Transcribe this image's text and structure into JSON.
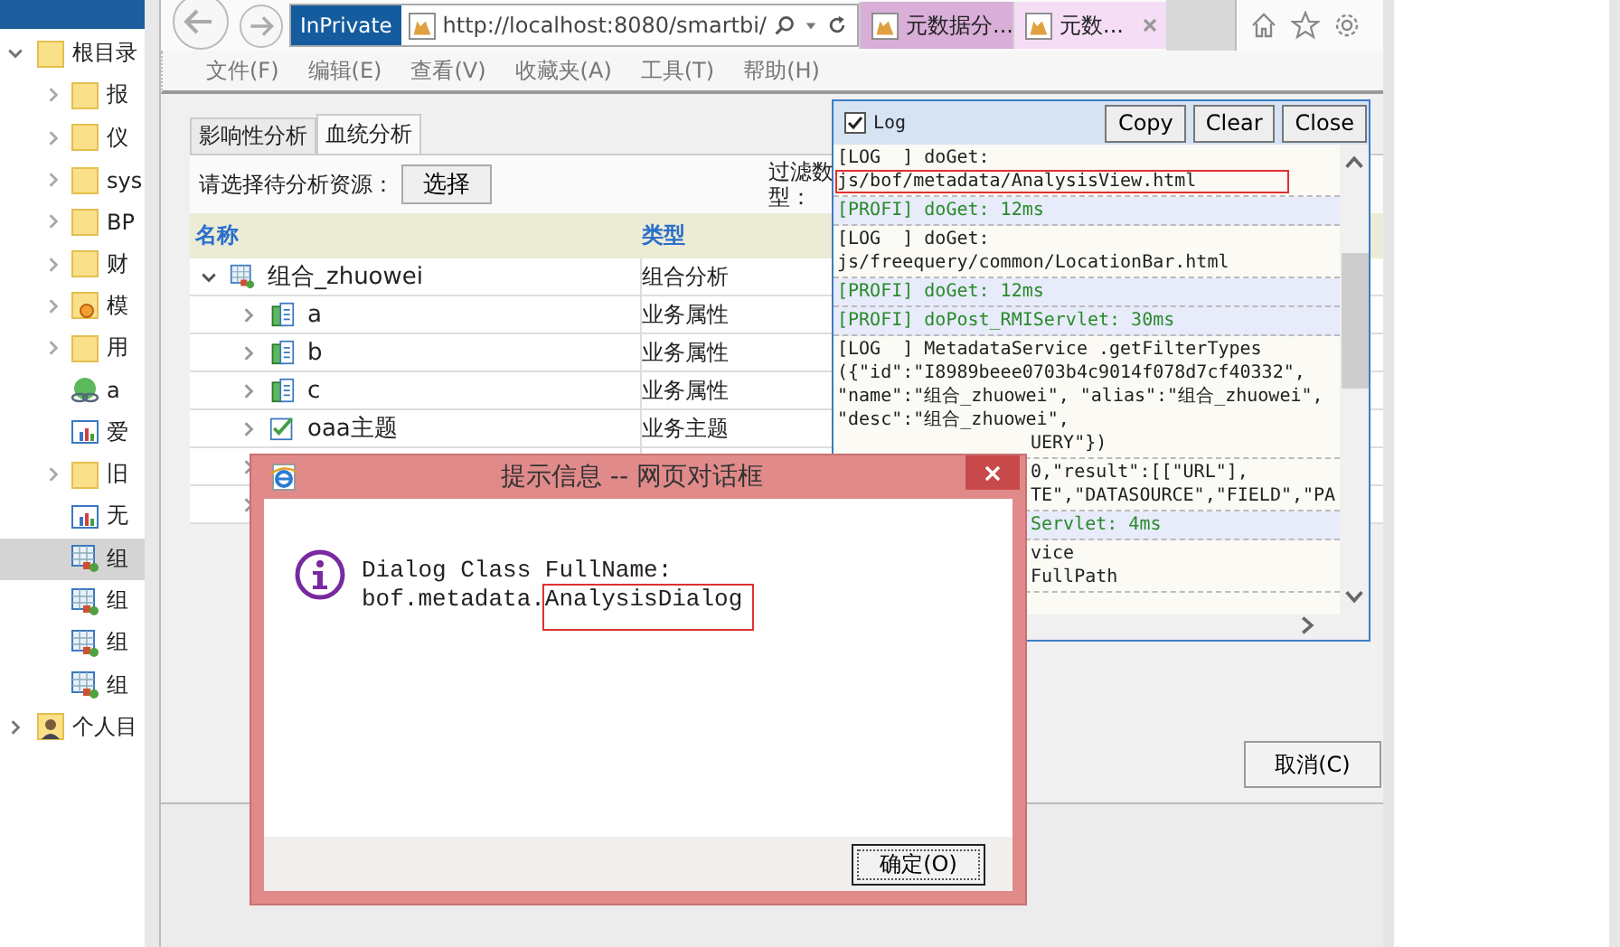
{
  "sidebar": {
    "items": [
      {
        "label": "根目录",
        "kind": "folder",
        "expanded": true,
        "selected": false,
        "children": [
          {
            "label": "报",
            "kind": "folder",
            "expanded": false,
            "selected": false
          },
          {
            "label": "仪",
            "kind": "folder",
            "expanded": false,
            "selected": false
          },
          {
            "label": "sys",
            "kind": "folder",
            "expanded": false,
            "selected": false
          },
          {
            "label": "BP",
            "kind": "folder",
            "expanded": false,
            "selected": false
          },
          {
            "label": "财",
            "kind": "folder",
            "expanded": false,
            "selected": false
          },
          {
            "label": "模",
            "kind": "model-folder",
            "expanded": false,
            "selected": false
          },
          {
            "label": "用",
            "kind": "folder",
            "expanded": false,
            "selected": false
          },
          {
            "label": "a",
            "kind": "link",
            "selected": false
          },
          {
            "label": "爱",
            "kind": "report",
            "selected": false
          },
          {
            "label": "旧",
            "kind": "folder",
            "expanded": false,
            "selected": false
          },
          {
            "label": "无",
            "kind": "report",
            "selected": false
          },
          {
            "label": "组",
            "kind": "combo",
            "selected": true
          },
          {
            "label": "组",
            "kind": "combo",
            "selected": false
          },
          {
            "label": "组",
            "kind": "combo",
            "selected": false
          },
          {
            "label": "组",
            "kind": "combo",
            "selected": false
          }
        ]
      },
      {
        "label": "个人目",
        "kind": "user-folder",
        "expanded": false,
        "selected": false
      }
    ]
  },
  "browser": {
    "private_label": "InPrivate",
    "url": "http://localhost:8080/smartbi/",
    "tabs": [
      {
        "label": "元数据分...",
        "selected": true
      },
      {
        "label": "元数...",
        "selected": false
      }
    ],
    "menu": [
      "文件(F)",
      "编辑(E)",
      "查看(V)",
      "收藏夹(A)",
      "工具(T)",
      "帮助(H)"
    ]
  },
  "page": {
    "tabs": [
      {
        "label": "影响性分析",
        "selected": false
      },
      {
        "label": "血统分析",
        "selected": true
      }
    ],
    "resource_label": "请选择待分析资源：",
    "select_button": "选择",
    "filter_label": "过滤数型：",
    "table": {
      "columns": [
        "名称",
        "类型"
      ],
      "rows": [
        {
          "name": "组合_zhuowei",
          "type": "组合分析",
          "kind": "combo",
          "expanded": true,
          "children": [
            {
              "name": "a",
              "type": "业务属性",
              "kind": "attribute",
              "expanded": false
            },
            {
              "name": "b",
              "type": "业务属性",
              "kind": "attribute",
              "expanded": false
            },
            {
              "name": "c",
              "type": "业务属性",
              "kind": "attribute",
              "expanded": false
            },
            {
              "name": "oaa主题",
              "type": "业务主题",
              "kind": "topic",
              "expanded": false
            },
            {
              "kind": "covered",
              "expanded": false
            },
            {
              "kind": "covered",
              "expanded": false
            }
          ]
        }
      ]
    },
    "cancel_button": "取消(C)"
  },
  "log": {
    "title": "Log",
    "checked": true,
    "buttons": [
      "Copy",
      "Clear",
      "Close"
    ],
    "entries": [
      {
        "kind": "log",
        "lines": [
          {
            "text": "[LOG  ] doGet:",
            "highlighted": false
          },
          {
            "text": "js/bof/metadata/AnalysisView.html",
            "highlighted": true
          }
        ]
      },
      {
        "kind": "profi",
        "lines": [
          {
            "text": "[PROFI] doGet: 12ms",
            "highlighted": false
          }
        ]
      },
      {
        "kind": "log",
        "lines": [
          {
            "text": "[LOG  ] doGet:",
            "highlighted": false
          },
          {
            "text": "js/freequery/common/LocationBar.html",
            "highlighted": false
          }
        ]
      },
      {
        "kind": "profi",
        "lines": [
          {
            "text": "[PROFI] doGet: 12ms",
            "highlighted": false
          }
        ]
      },
      {
        "kind": "profi",
        "lines": [
          {
            "text": "[PROFI] doPost_RMIServlet: 30ms",
            "highlighted": false
          }
        ]
      },
      {
        "kind": "log",
        "lines": [
          {
            "text": "[LOG  ] MetadataService .getFilterTypes",
            "highlighted": false
          },
          {
            "text": "({\"id\":\"I8989beee0703b4c9014f078d7cf40332\",",
            "highlighted": false
          },
          {
            "text": "\"name\":\"组合_zhuowei\", \"alias\":\"组合_zhuowei\",",
            "highlighted": false
          },
          {
            "text": "\"desc\":\"组合_zhuowei\",",
            "highlighted": false
          }
        ],
        "covered_lines": [
          "UERY\"})"
        ]
      },
      {
        "kind": "log",
        "covered_lines": [
          "0,\"result\":[[\"URL\"],",
          "TE\",\"DATASOURCE\",\"FIELD\",\"PA"
        ]
      },
      {
        "kind": "profi",
        "covered_lines": [
          "Servlet: 4ms"
        ]
      },
      {
        "kind": "log",
        "covered_lines": [
          "vice",
          "FullPath"
        ]
      }
    ]
  },
  "dialog": {
    "title": "提示信息 -- 网页对话框",
    "message": "Dialog Class FullName:",
    "detail_prefix": "bof.metadata.",
    "detail_highlight": "AnalysisDialog",
    "ok_button": "确定(O)"
  }
}
